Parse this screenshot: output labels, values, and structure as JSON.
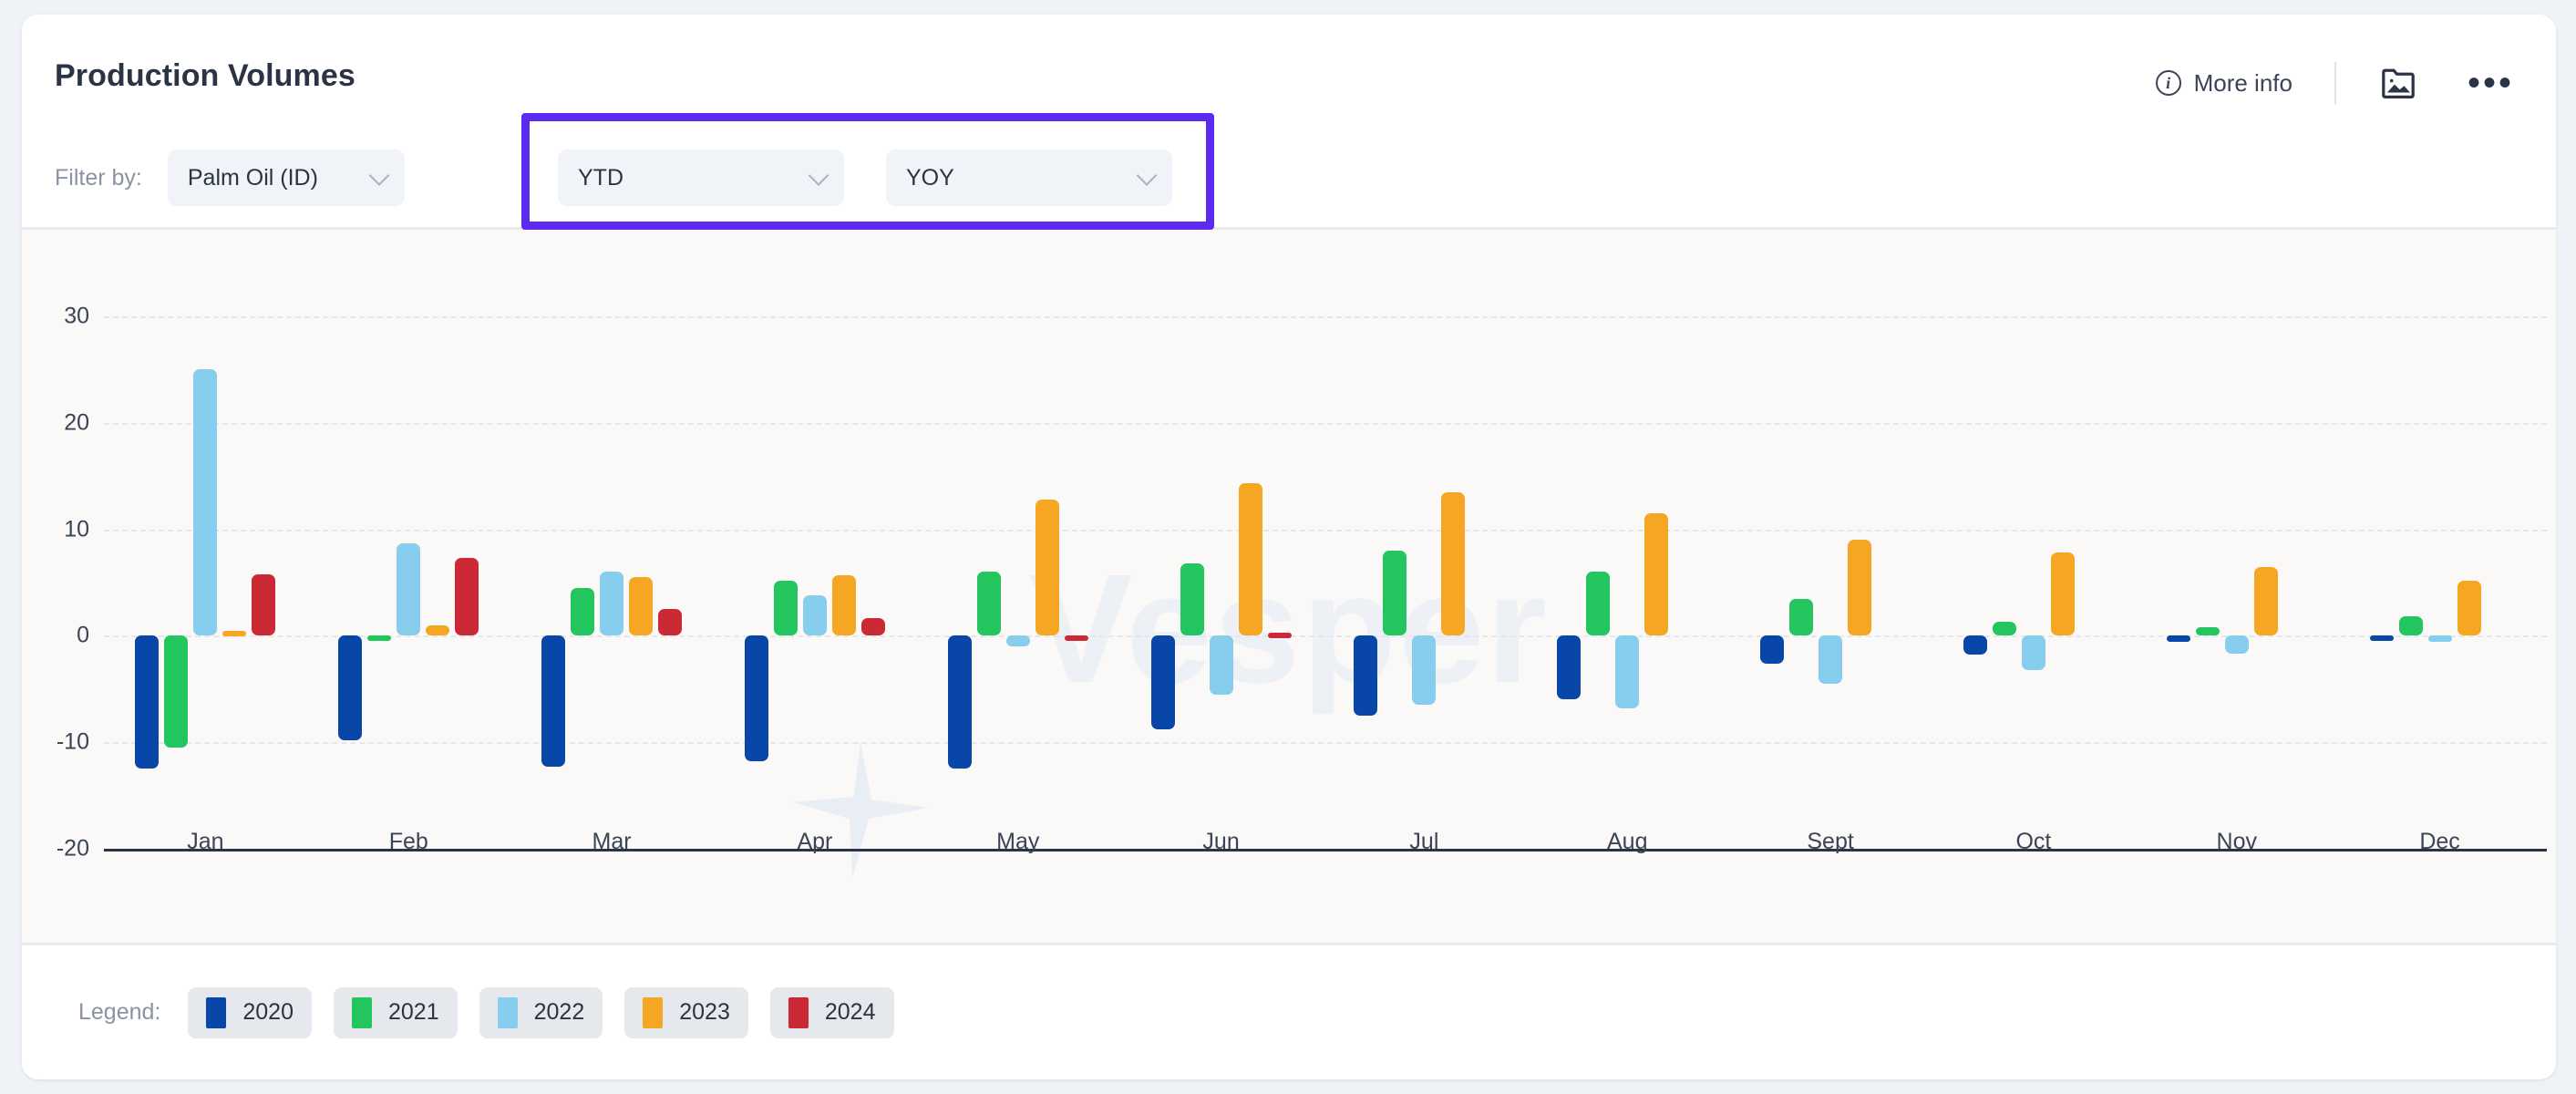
{
  "header": {
    "title": "Production Volumes",
    "more_info_label": "More info",
    "info_icon": "info-circle-icon",
    "image_icon": "image-folder-icon",
    "overflow_icon": "ellipsis-icon"
  },
  "filters": {
    "label": "Filter by:",
    "commodity": {
      "value": "Palm Oil (ID)"
    },
    "period": {
      "value": "YTD"
    },
    "comparison": {
      "value": "YOY"
    },
    "highlight_color": "#5b2aee"
  },
  "legend": {
    "label": "Legend:",
    "items": [
      {
        "label": "2020",
        "color": "#0847a8"
      },
      {
        "label": "2021",
        "color": "#23c55e"
      },
      {
        "label": "2022",
        "color": "#87cdee"
      },
      {
        "label": "2023",
        "color": "#f5a623"
      },
      {
        "label": "2024",
        "color": "#cc2936"
      }
    ]
  },
  "watermark": {
    "text": "Vesper"
  },
  "chart_data": {
    "type": "bar",
    "title": "Production Volumes",
    "xlabel": "",
    "ylabel": "",
    "ylim": [
      -20,
      33
    ],
    "yticks": [
      30,
      20,
      10,
      0,
      -10,
      -20
    ],
    "ytick_labels": [
      "30",
      "20",
      "10",
      "0",
      "-10",
      "-20"
    ],
    "grid": true,
    "legend_position": "bottom",
    "categories": [
      "Jan",
      "Feb",
      "Mar",
      "Apr",
      "May",
      "Jun",
      "Jul",
      "Aug",
      "Sept",
      "Oct",
      "Nov",
      "Dec"
    ],
    "series": [
      {
        "name": "2020",
        "color": "#0847a8",
        "values": [
          -12.5,
          -9.8,
          -12.3,
          -11.8,
          -12.5,
          -8.8,
          -7.5,
          -6.0,
          -2.6,
          -1.8,
          -0.6,
          -0.5
        ]
      },
      {
        "name": "2021",
        "color": "#23c55e",
        "values": [
          -10.5,
          0.0,
          4.5,
          5.2,
          6.0,
          6.8,
          8.0,
          6.0,
          3.5,
          1.3,
          0.8,
          1.8
        ]
      },
      {
        "name": "2022",
        "color": "#87cdee",
        "values": [
          25.0,
          8.7,
          6.0,
          3.8,
          -1.0,
          -5.5,
          -6.5,
          -6.8,
          -4.5,
          -3.2,
          -1.7,
          -0.6
        ]
      },
      {
        "name": "2023",
        "color": "#f5a623",
        "values": [
          0.5,
          1.0,
          5.5,
          5.7,
          12.8,
          14.3,
          13.5,
          11.5,
          9.0,
          7.8,
          6.5,
          5.2
        ]
      },
      {
        "name": "2024",
        "color": "#cc2936",
        "values": [
          5.8,
          7.3,
          2.5,
          1.7,
          -0.4,
          0.3,
          null,
          null,
          null,
          null,
          null,
          null
        ]
      }
    ]
  }
}
